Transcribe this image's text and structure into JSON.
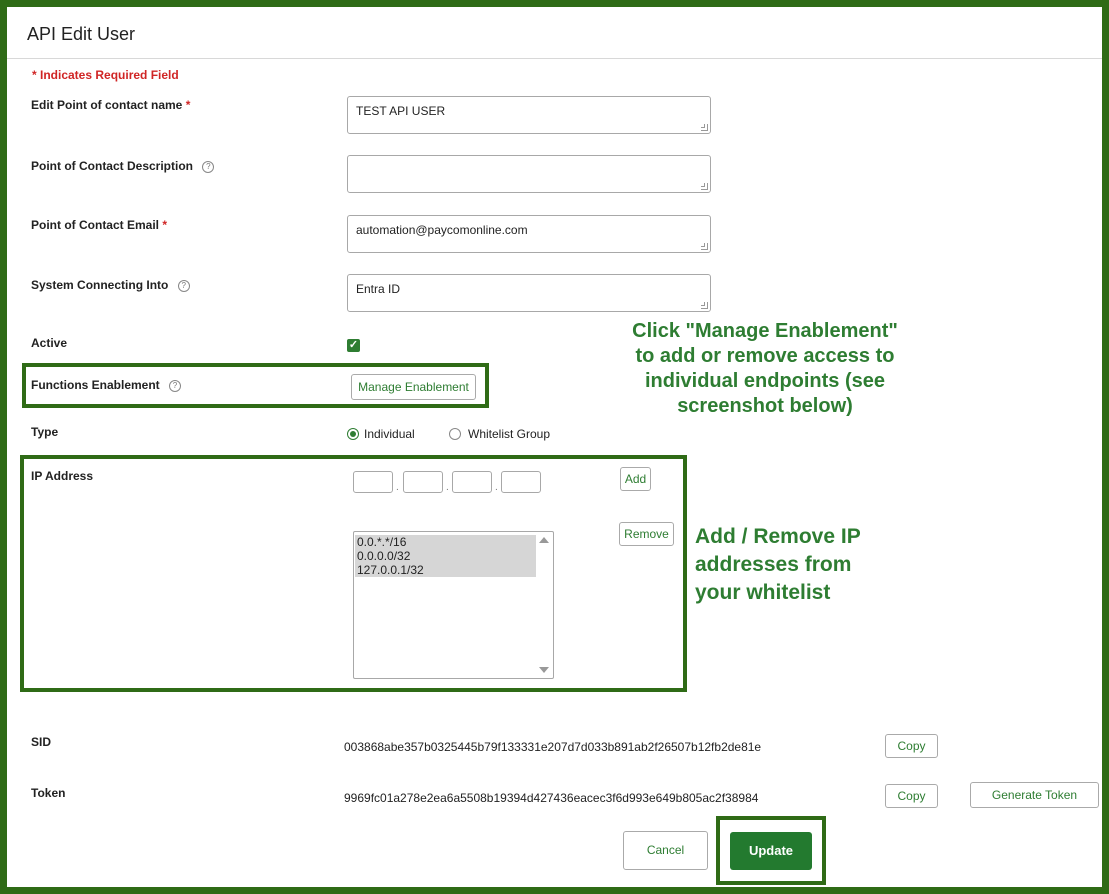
{
  "page": {
    "title": "API Edit User",
    "required_note": "* Indicates Required Field"
  },
  "fields": {
    "contact_name": {
      "label": "Edit Point of contact name",
      "required_mark": "*",
      "value": "TEST API USER"
    },
    "description": {
      "label": "Point of Contact Description",
      "value": ""
    },
    "email": {
      "label": "Point of Contact Email",
      "required_mark": "*",
      "value": "automation@paycomonline.com"
    },
    "system": {
      "label": "System Connecting Into",
      "value": "Entra ID"
    },
    "active": {
      "label": "Active",
      "checked": true
    },
    "functions": {
      "label": "Functions Enablement",
      "button": "Manage Enablement"
    },
    "type": {
      "label": "Type",
      "options": [
        "Individual",
        "Whitelist Group"
      ],
      "selected": "Individual"
    },
    "ip": {
      "label": "IP Address",
      "add_button": "Add",
      "remove_button": "Remove",
      "list": [
        "0.0.*.*/16",
        "0.0.0.0/32",
        "127.0.0.1/32"
      ]
    },
    "sid": {
      "label": "SID",
      "value": "003868abe357b0325445b79f133331e207d7d033b891ab2f26507b12fb2de81e",
      "copy_button": "Copy"
    },
    "token": {
      "label": "Token",
      "value": "9969fc01a278e2ea6a5508b19394d427436eacec3f6d993e649b805ac2f38984",
      "copy_button": "Copy",
      "generate_button": "Generate Token"
    }
  },
  "actions": {
    "cancel": "Cancel",
    "update": "Update"
  },
  "callouts": {
    "manage": [
      "Click \"Manage Enablement\"",
      "to add or remove access to",
      "individual endpoints (see",
      "screenshot below)"
    ],
    "ip": [
      "Add / Remove IP",
      "addresses from",
      "your whitelist"
    ]
  },
  "colors": {
    "accent": "#2e7d32",
    "frame": "#2f6b16",
    "required": "#d02525"
  }
}
